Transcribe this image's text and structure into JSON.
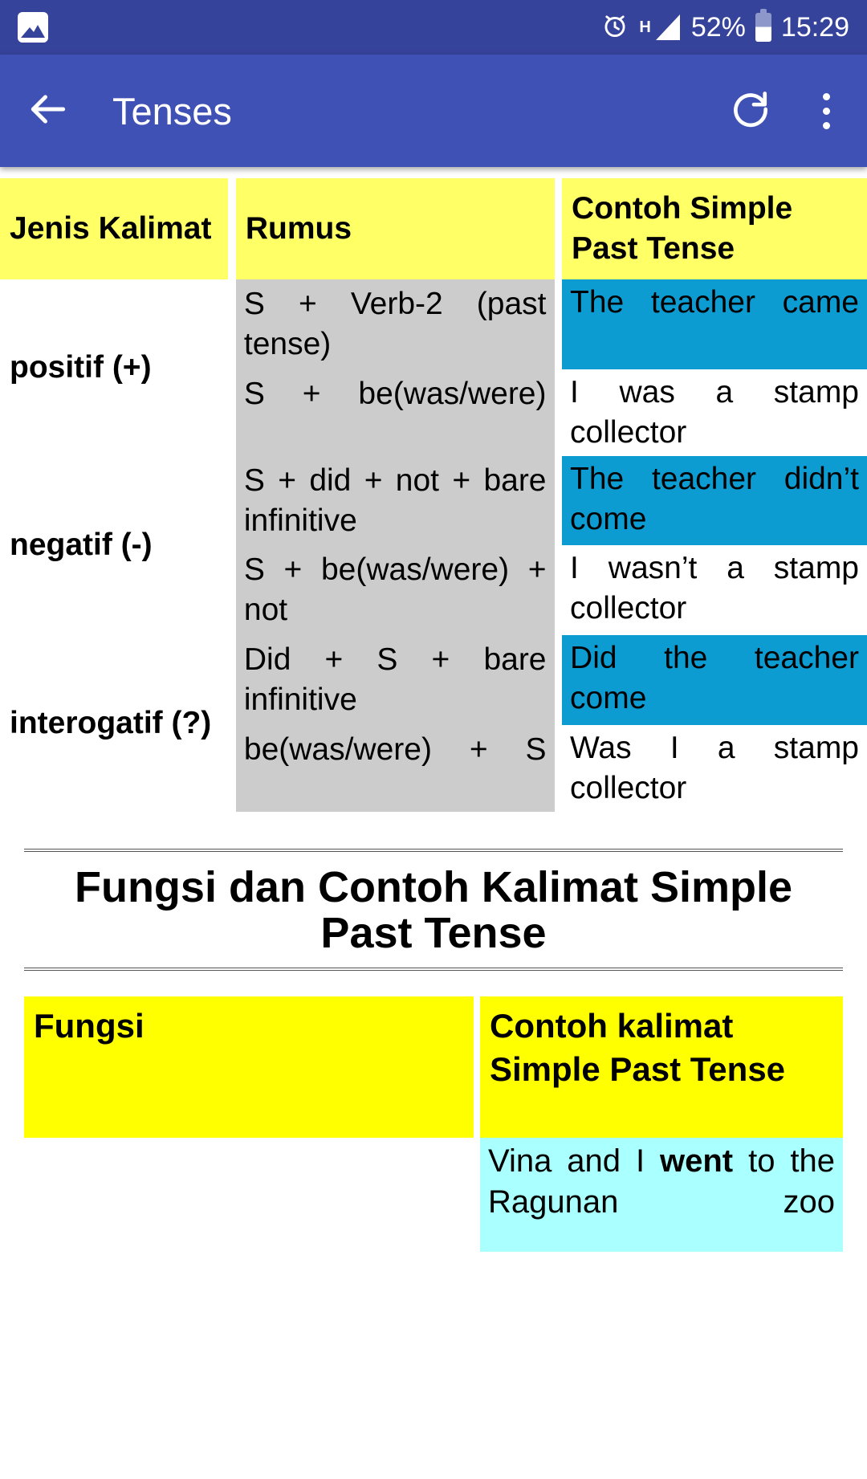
{
  "status_bar": {
    "notification_icon": "image-gallery-icon",
    "alarm_icon": "alarm-clock-icon",
    "network_type": "H",
    "signal_icon": "signal-triangle-icon",
    "battery_percent": "52%",
    "battery_icon": "battery-icon",
    "clock": "15:29"
  },
  "app_bar": {
    "back_icon": "back-arrow-icon",
    "title": "Tenses",
    "refresh_icon": "refresh-icon",
    "overflow_icon": "overflow-menu-icon"
  },
  "tense_table": {
    "headers": {
      "col1": "Jenis Kalimat",
      "col2": "Rumus",
      "col3": "Contoh Simple Past Tense"
    },
    "rows": [
      {
        "jenis": "positif (+)",
        "formulas": [
          "S + Verb-2 (past tense)",
          "S + be(was/were)"
        ],
        "examples": [
          {
            "text": "The teacher came",
            "highlight": "blue"
          },
          {
            "text": "I was a stamp collector",
            "highlight": "none"
          }
        ]
      },
      {
        "jenis": "negatif (-)",
        "formulas": [
          "S + did + not + bare infinitive",
          "S + be(was/were) + not"
        ],
        "examples": [
          {
            "text": "The teacher didn’t come",
            "highlight": "blue"
          },
          {
            "text": "I wasn’t a stamp collector",
            "highlight": "none"
          }
        ]
      },
      {
        "jenis": "interogatif (?)",
        "formulas": [
          "Did + S + bare infinitive",
          "be(was/were) + S"
        ],
        "examples": [
          {
            "text": "Did the teacher come",
            "highlight": "blue"
          },
          {
            "text": "Was I a stamp collector",
            "highlight": "none"
          }
        ]
      }
    ]
  },
  "section_heading": "Fungsi dan Contoh Kalimat Simple Past Tense",
  "fungsi_table": {
    "headers": {
      "col1": "Fungsi",
      "col2": "Contoh kalimat Simple Past Tense"
    },
    "rows": [
      {
        "fungsi": "",
        "contoh_prefix": "Vina and I ",
        "contoh_bold": "went",
        "contoh_suffix": " to the Ragunan zoo"
      }
    ]
  },
  "colors": {
    "status_bar": "#36439a",
    "app_bar": "#4051b5",
    "header_yellow": "#ffff66",
    "bottom_yellow": "#ffff00",
    "formula_gray": "#cccccc",
    "example_blue": "#0d9cd2",
    "example_cyan": "#aaffff"
  }
}
